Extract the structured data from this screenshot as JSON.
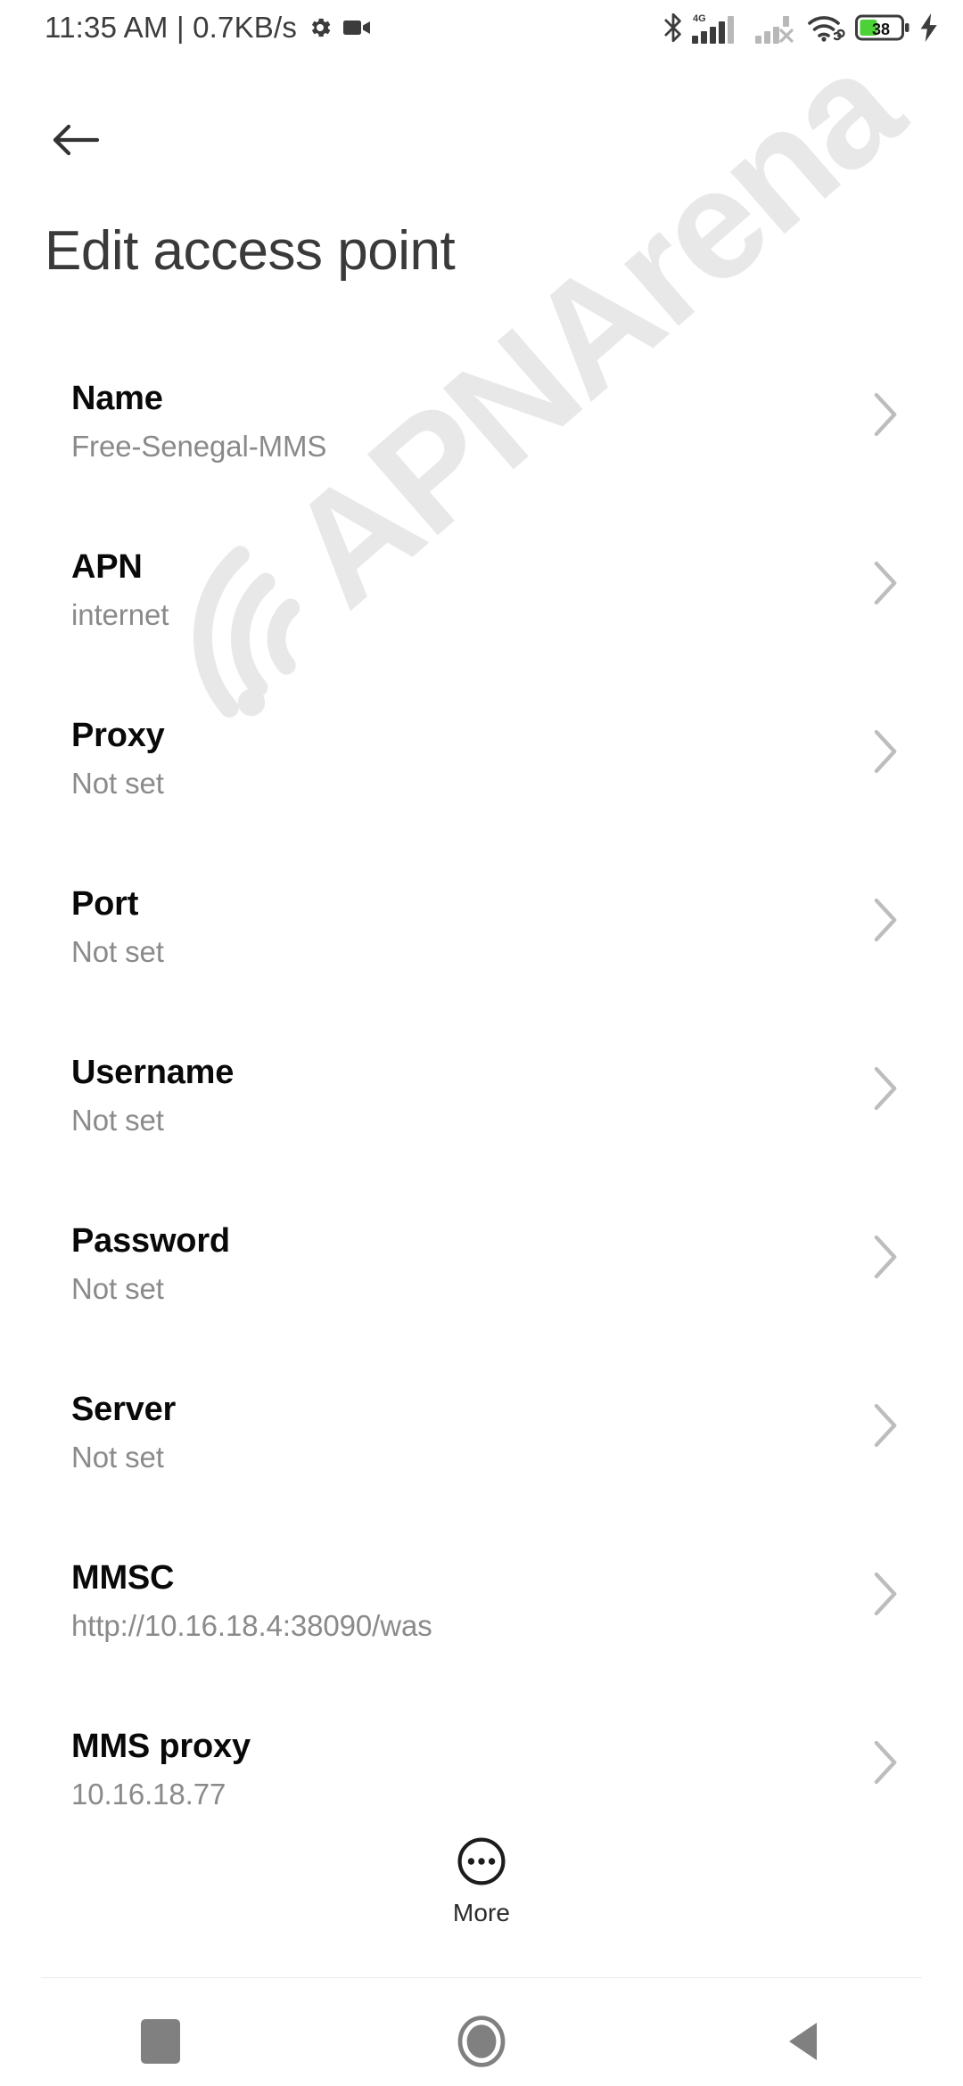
{
  "status_bar": {
    "clock": "11:35 AM",
    "separator": "|",
    "data_rate": "0.7KB/s",
    "icons_left": [
      "gear-icon",
      "video-camera-icon"
    ],
    "icons_right": [
      "bluetooth-icon",
      "signal-4g-icon",
      "signal-sim2-off-icon",
      "wifi-icon",
      "battery-icon",
      "charging-bolt-icon"
    ],
    "network_type": "4G",
    "battery_level": "38",
    "battery_color": "#4cd137"
  },
  "header": {
    "back_icon": "arrow-left-icon",
    "title": "Edit access point"
  },
  "list": {
    "chevron_icon": "chevron-right-icon",
    "rows": [
      {
        "label": "Name",
        "value": "Free-Senegal-MMS"
      },
      {
        "label": "APN",
        "value": "internet"
      },
      {
        "label": "Proxy",
        "value": "Not set"
      },
      {
        "label": "Port",
        "value": "Not set"
      },
      {
        "label": "Username",
        "value": "Not set"
      },
      {
        "label": "Password",
        "value": "Not set"
      },
      {
        "label": "Server",
        "value": "Not set"
      },
      {
        "label": "MMSC",
        "value": "http://10.16.18.4:38090/was"
      },
      {
        "label": "MMS proxy",
        "value": "10.16.18.77"
      }
    ]
  },
  "more_button": {
    "label": "More",
    "icon": "more-dots-circle-icon"
  },
  "watermark": {
    "text": "APNArena",
    "logo_icon": "wifi-arcs-icon",
    "color": "#e8e8e8"
  },
  "nav_bar": {
    "recents_icon": "square-icon",
    "home_icon": "circle-icon",
    "back_icon": "triangle-back-icon",
    "color": "#808080"
  }
}
